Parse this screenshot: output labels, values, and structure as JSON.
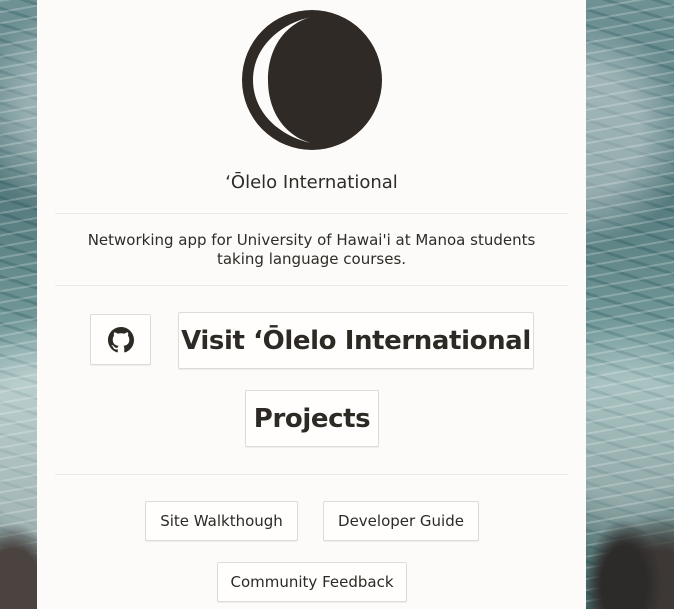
{
  "site": {
    "title": "ʻŌlelo International",
    "description": "Networking app for University of Hawai'i at Manoa students taking language courses."
  },
  "icons": {
    "logo": "crescent-moon-logo",
    "github": "github-icon"
  },
  "buttons": {
    "visit": "Visit ʻŌlelo International",
    "projects": "Projects",
    "walkthrough": "Site Walkthough",
    "developer_guide": "Developer Guide",
    "community_feedback": "Community Feedback"
  },
  "colors": {
    "logo": "#2f2a26",
    "card_background": "#fcfbf9",
    "text": "#2f2b27"
  }
}
